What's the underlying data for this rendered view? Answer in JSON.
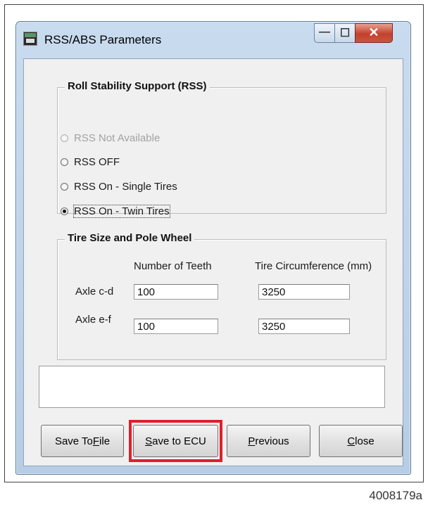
{
  "window": {
    "title": "RSS/ABS Parameters",
    "app_icon": "rss-app-icon"
  },
  "controls": {
    "minimize": "—",
    "maximize": "☐",
    "close": "✕"
  },
  "rss_group": {
    "legend": "Roll Stability Support (RSS)",
    "options": [
      {
        "label": "RSS Not Available",
        "selected": false,
        "disabled": true
      },
      {
        "label": "RSS OFF",
        "selected": false,
        "disabled": false
      },
      {
        "label": "RSS On - Single Tires",
        "selected": false,
        "disabled": false
      },
      {
        "label": "RSS On - Twin Tires",
        "selected": true,
        "disabled": false
      }
    ]
  },
  "tire_group": {
    "legend": "Tire Size and Pole Wheel",
    "col_teeth": "Number of Teeth",
    "col_circ": "Tire Circumference (mm)",
    "rows": [
      {
        "label": "Axle c-d",
        "teeth": "100",
        "circumference": "3250"
      },
      {
        "label": "Axle e-f",
        "teeth": "100",
        "circumference": "3250"
      }
    ]
  },
  "message_box": "",
  "buttons": {
    "save_to_file": {
      "prefix": "Save To ",
      "mnemonic": "F",
      "suffix": "ile"
    },
    "save_to_ecu": {
      "prefix": "",
      "mnemonic": "S",
      "suffix": "ave to ECU"
    },
    "previous": {
      "prefix": "",
      "mnemonic": "P",
      "suffix": "revious"
    },
    "close": {
      "prefix": "",
      "mnemonic": "C",
      "suffix": "lose"
    }
  },
  "highlight_color": "#e0202a",
  "figure_caption": "4008179a"
}
